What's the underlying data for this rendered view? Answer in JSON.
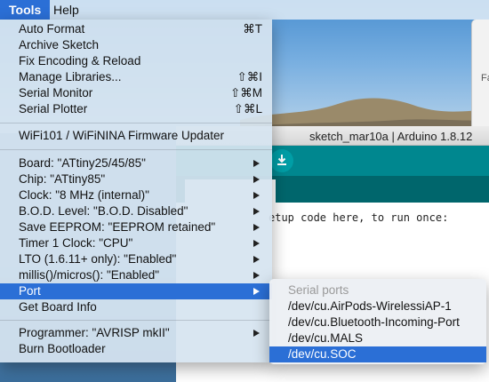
{
  "menubar": {
    "tools": "Tools",
    "help": "Help"
  },
  "app_window": {
    "title": "sketch_mar10a | Arduino 1.8.12",
    "code_line": "etup code here, to run once:",
    "toolbar_icon": "download-icon"
  },
  "background_dialog": {
    "text": "Fa"
  },
  "tools_menu": {
    "items": [
      {
        "label": "Auto Format",
        "shortcut": "⌘T"
      },
      {
        "label": "Archive Sketch",
        "shortcut": ""
      },
      {
        "label": "Fix Encoding & Reload",
        "shortcut": ""
      },
      {
        "label": "Manage Libraries...",
        "shortcut": "⇧⌘I"
      },
      {
        "label": "Serial Monitor",
        "shortcut": "⇧⌘M"
      },
      {
        "label": "Serial Plotter",
        "shortcut": "⇧⌘L"
      },
      {
        "label": "WiFi101 / WiFiNINA Firmware Updater",
        "shortcut": ""
      },
      {
        "label": "Board: \"ATtiny25/45/85\"",
        "submenu": true
      },
      {
        "label": "Chip: \"ATtiny85\"",
        "submenu": true
      },
      {
        "label": "Clock: \"8 MHz (internal)\"",
        "submenu": true
      },
      {
        "label": "B.O.D. Level: \"B.O.D. Disabled\"",
        "submenu": true
      },
      {
        "label": "Save EEPROM: \"EEPROM retained\"",
        "submenu": true
      },
      {
        "label": "Timer 1 Clock: \"CPU\"",
        "submenu": true
      },
      {
        "label": "LTO (1.6.11+ only): \"Enabled\"",
        "submenu": true
      },
      {
        "label": "millis()/micros(): \"Enabled\"",
        "submenu": true
      },
      {
        "label": "Port",
        "submenu": true,
        "highlighted": true
      },
      {
        "label": "Get Board Info",
        "shortcut": ""
      },
      {
        "label": "Programmer: \"AVRISP mkII\"",
        "submenu": true
      },
      {
        "label": "Burn Bootloader",
        "shortcut": ""
      }
    ]
  },
  "port_submenu": {
    "header": "Serial ports",
    "ports": [
      "/dev/cu.AirPods-WirelessiAP-1",
      "/dev/cu.Bluetooth-Incoming-Port",
      "/dev/cu.MALS",
      "/dev/cu.SOC"
    ],
    "selected_index": 3
  },
  "colors": {
    "highlight": "#2b6fd6",
    "arduino_teal": "#00878f"
  }
}
